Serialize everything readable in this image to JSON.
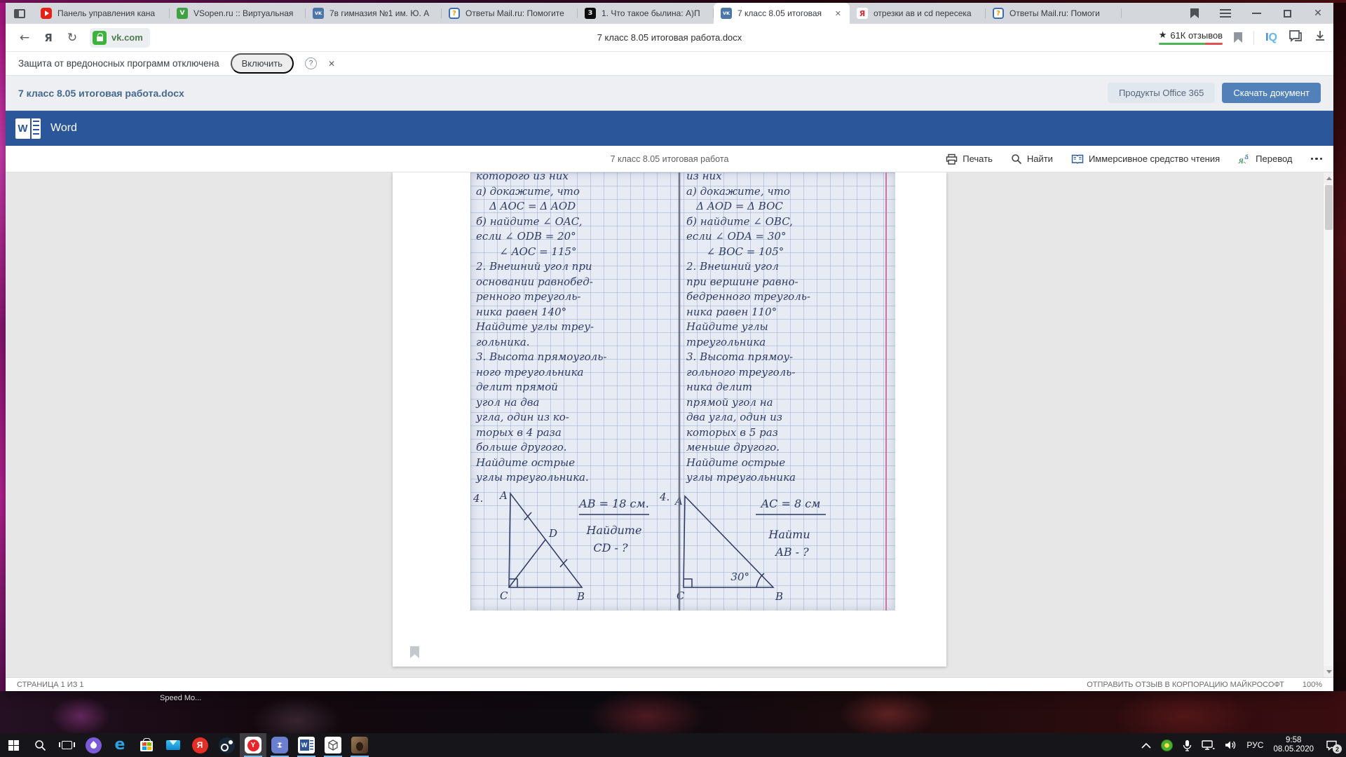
{
  "browser": {
    "tabs": [
      {
        "title": "Панель управления кана",
        "icon": "youtube"
      },
      {
        "title": "VSopen.ru :: Виртуальная",
        "icon": "vsopen"
      },
      {
        "title": "7в гимназия №1 им. Ю. А",
        "icon": "vk"
      },
      {
        "title": "Ответы Mail.ru: Помогите",
        "icon": "otvety"
      },
      {
        "title": "1. Что такое былина: А)П",
        "icon": "znanija"
      },
      {
        "title": "7 класс 8.05 итоговая",
        "icon": "vk",
        "active": true,
        "close_glyph": "✕"
      },
      {
        "title": "отрезки ав и cd пересека",
        "icon": "yandex"
      },
      {
        "title": "Ответы Mail.ru: Помоги",
        "icon": "otvety"
      }
    ],
    "address": {
      "url": "vk.com",
      "page_title": "7 класс 8.05 итоговая работа.docx",
      "reviews_label": "61К отзывов",
      "star_glyph": "★",
      "iq_i": "I",
      "iq_q": "Q",
      "back_glyph": "←",
      "yandex_glyph": "Я",
      "refresh_glyph": "↻"
    },
    "warning": {
      "text": "Защита от вредоносных программ отключена",
      "enable_button": "Включить",
      "help_glyph": "?",
      "close_glyph": "✕"
    },
    "window_close_glyph": "✕"
  },
  "vk_header": {
    "title": "7 класс 8.05 итоговая работа.docx",
    "office_button": "Продукты Office 365",
    "download_button": "Скачать документ"
  },
  "word": {
    "brand": "Word",
    "logo_letter": "W",
    "doc_title": "7 класс 8.05 итоговая работа",
    "toolbar": {
      "print": "Печать",
      "find": "Найти",
      "immersive": "Иммерсивное средство чтения",
      "translate": "Перевод"
    },
    "status": {
      "page": "СТРАНИЦА 1 ИЗ 1",
      "feedback": "ОТПРАВИТЬ ОТЗЫВ В КОРПОРАЦИЮ МАЙКРОСОФТ",
      "zoom": "100%"
    }
  },
  "scan": {
    "left_lines": [
      "которого из них",
      "а) докажите, что",
      "    Δ AOC = Δ AOD",
      "б) найдите ∠ OAC,",
      "если ∠ ODB = 20°",
      "       ∠ AOC = 115°",
      "2. Внешний угол при",
      "основании равнобед-",
      "ренного треуголь-",
      "ника равен 140°",
      "Найдите углы треу-",
      "гольника.",
      "3. Высота прямоуголь-",
      "ного треугольника",
      "делит прямой",
      "угол на два",
      "угла, один из ко-",
      "торых в 4 раза",
      "больше другого.",
      "Найдите острые",
      "углы треугольника."
    ],
    "right_lines": [
      "из них",
      "а) докажите, что",
      "   Δ AOD = Δ BOC",
      "б) найдите ∠ OBC,",
      "если ∠ ODA = 30°",
      "      ∠ BOC = 105°",
      "2. Внешний угол",
      "при вершине равно-",
      "бедренного треуголь-",
      "ника равен 110°",
      "Найдите углы",
      "треугольника",
      "3. Высота прямоу-",
      "гольного треуголь-",
      "ника делит",
      "прямой угол на",
      "два угла, один из",
      "которых в 5 раз",
      "меньше другого.",
      "Найдите острые",
      "углы треугольника"
    ],
    "fig_left": {
      "num": "4.",
      "a": "A",
      "b": "B",
      "c": "C",
      "d": "D",
      "given": "AB = 18 см.",
      "find1": "Найдите",
      "find2": "CD - ?"
    },
    "fig_right": {
      "num": "4.",
      "a": "A",
      "b": "B",
      "c": "C",
      "angle": "30°",
      "given": "AC = 8 см",
      "find1": "Найти",
      "find2": "AB - ?"
    }
  },
  "desktop": {
    "icon_label": "Speed Mo..."
  },
  "taskbar": {
    "lang": "РУС",
    "time": "9:58",
    "date": "08.05.2020",
    "notif_badge": "2"
  }
}
